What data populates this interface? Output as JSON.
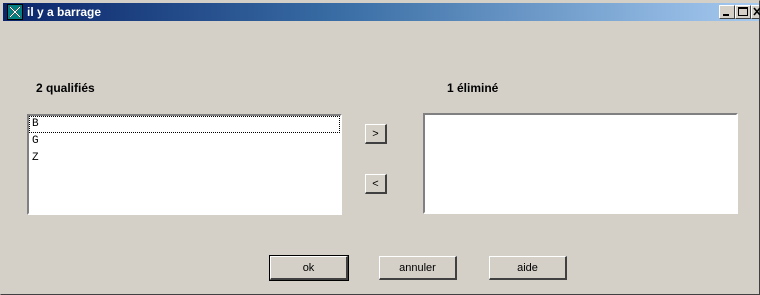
{
  "window": {
    "title": "il y a barrage",
    "app_icon": "x-cross-icon",
    "controls": [
      "minimize-icon",
      "maximize-icon",
      "close-icon"
    ]
  },
  "qualified": {
    "label": "2 qualifiés",
    "items": [
      "B",
      "G",
      "Z"
    ]
  },
  "eliminated": {
    "label": "1 éliminé",
    "items": []
  },
  "move": {
    "right_label": ">",
    "left_label": "<"
  },
  "footer": {
    "ok_label": "ok",
    "cancel_label": "annuler",
    "help_label": "aide"
  }
}
